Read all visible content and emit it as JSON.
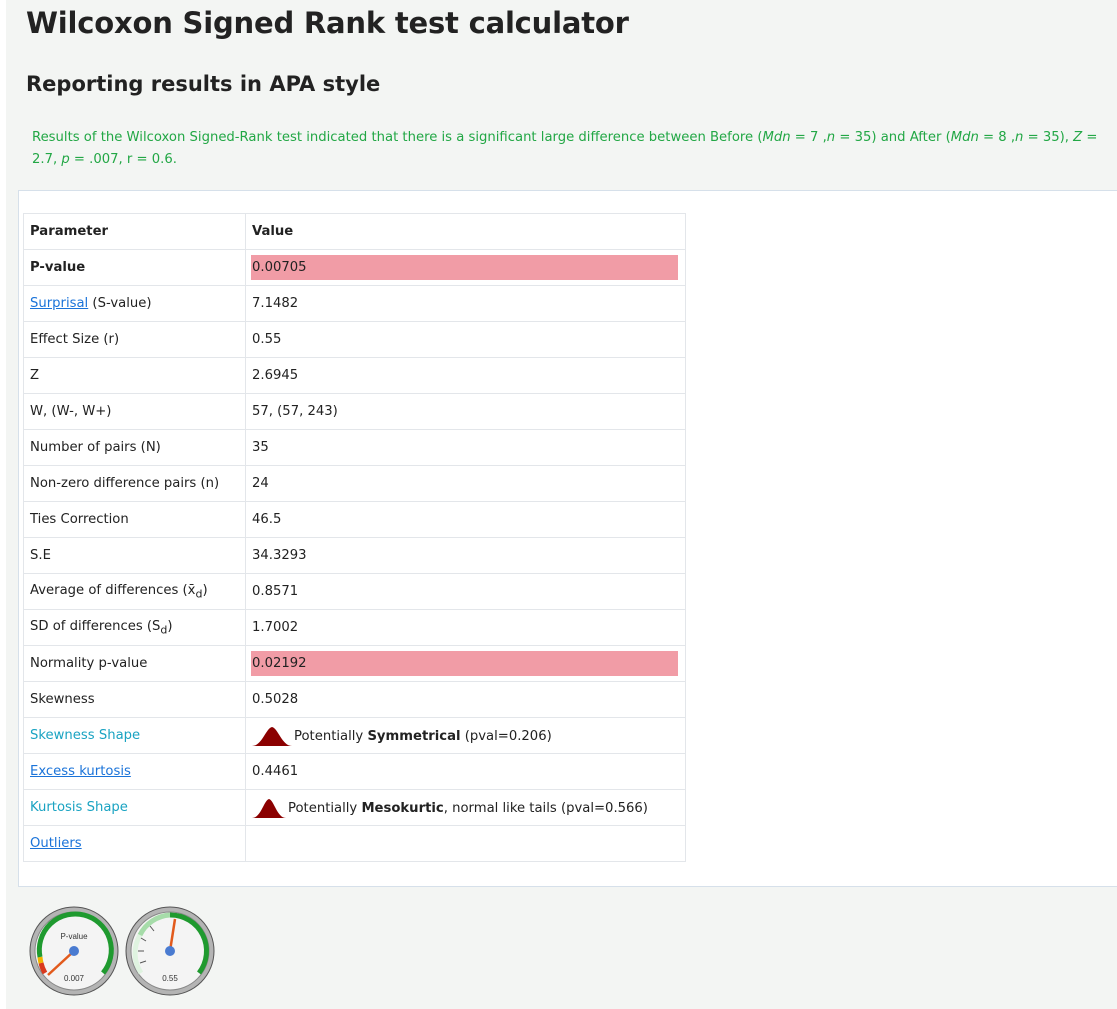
{
  "header": {
    "title": "Wilcoxon Signed Rank test calculator",
    "subtitle": "Reporting results in APA style"
  },
  "apa": {
    "prefix": "Results of the Wilcoxon Signed-Rank test indicated that there is a significant large difference between Before (",
    "mdn1_label": "Mdn",
    "mdn1_value": " = 7 ,",
    "n1_label": "n",
    "n1_value": " = 35) and After (",
    "mdn2_label": "Mdn",
    "mdn2_value": " = 8 ,",
    "n2_label": "n",
    "n2_value": " = 35), ",
    "z_label": "Z",
    "z_value": " = 2.7, ",
    "p_label": "p",
    "p_value": " = .007, r = 0.6."
  },
  "table": {
    "header": {
      "param": "Parameter",
      "value": "Value"
    },
    "rows": {
      "pvalue": {
        "label": "P-value",
        "value": "0.00705"
      },
      "surprisal": {
        "link": "Surprisal",
        "label_suffix": " (S-value)",
        "value": "7.1482"
      },
      "effect": {
        "label": "Effect Size (r)",
        "value": "0.55"
      },
      "z": {
        "label": "Z",
        "value": "2.6945"
      },
      "w": {
        "label": "W, (W-, W+)",
        "value": "57, (57, 243)"
      },
      "npairs": {
        "label": "Number of pairs (N)",
        "value": "35"
      },
      "nonzero": {
        "label": "Non-zero difference pairs (n)",
        "value": "24"
      },
      "ties": {
        "label": "Ties Correction",
        "value": "46.5"
      },
      "se": {
        "label": "S.E",
        "value": "34.3293"
      },
      "avgdiff": {
        "label": "Average of differences (x̄",
        "label_sub": "d",
        "label_end": ")",
        "value": "0.8571"
      },
      "sddiff": {
        "label": "SD of differences (S",
        "label_sub": "d",
        "label_end": ")",
        "value": "1.7002"
      },
      "normality": {
        "label": "Normality p-value",
        "value": "0.02192"
      },
      "skewness": {
        "label": "Skewness",
        "value": "0.5028"
      },
      "skewshape": {
        "label": "Skewness Shape",
        "v_pre": "Potentially ",
        "v_bold": "Symmetrical",
        "v_post": " (pval=0.206)"
      },
      "kurtosis": {
        "label": "Excess kurtosis",
        "value": "0.4461"
      },
      "kurtshape": {
        "label": "Kurtosis Shape",
        "v_pre": "Potentially ",
        "v_bold": "Mesokurtic",
        "v_post": ", normal like tails (pval=0.566)"
      },
      "outliers": {
        "label": "Outliers",
        "value": ""
      }
    }
  },
  "gauges": {
    "pvalue": {
      "title": "P-value",
      "reading": "0.007",
      "level": 0.007
    },
    "effect": {
      "reading": "0.55",
      "level": 0.55
    }
  },
  "colors": {
    "apa_text": "#22a745",
    "highlight": "#f19ca6",
    "link": "#1a73d9",
    "teal_label": "#1aa3c2",
    "bell": "#8b0000"
  },
  "icons": {
    "bell_shape": "bell-curve-icon",
    "gauge": "gauge-icon"
  }
}
